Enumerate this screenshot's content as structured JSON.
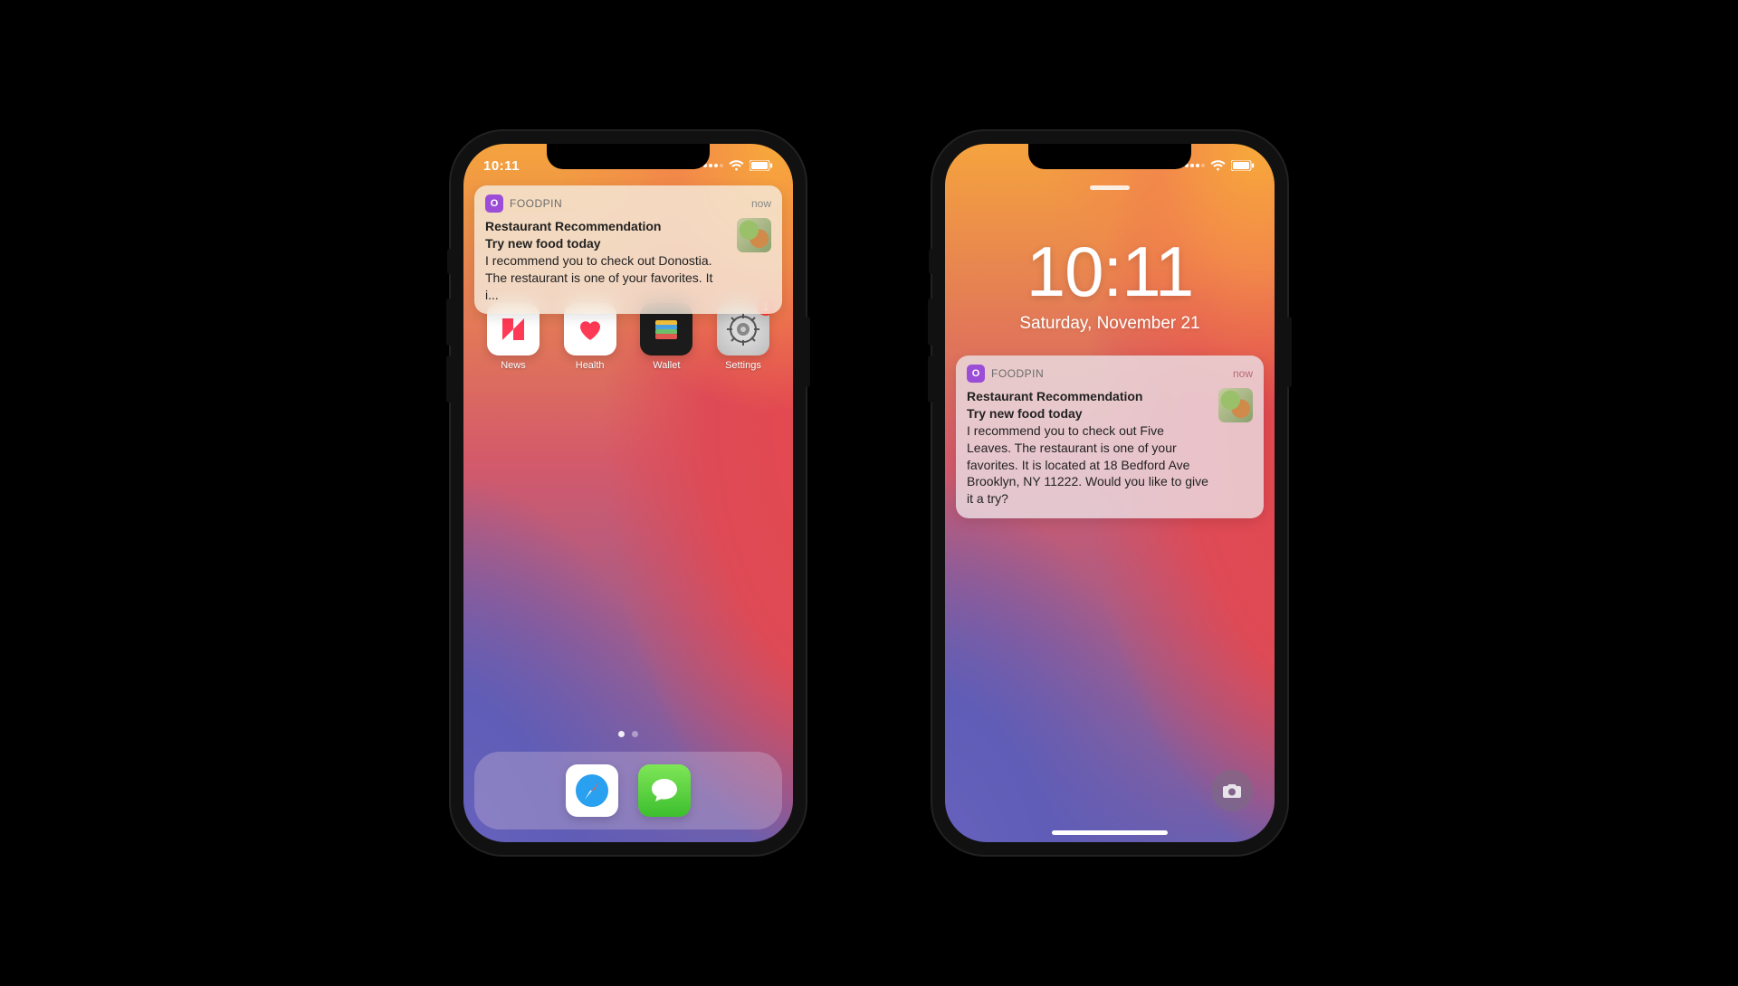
{
  "phone1": {
    "status_time": "10:11",
    "notif": {
      "app_icon_letter": "O",
      "app_name": "FOODPIN",
      "time": "now",
      "title": "Restaurant Recommendation",
      "subtitle": "Try new food today",
      "body": "I recommend you to check out Donostia. The restaurant is one of your favorites. It i..."
    },
    "apps": {
      "news": "News",
      "health": "Health",
      "wallet": "Wallet",
      "settings": "Settings",
      "settings_badge": "1"
    }
  },
  "phone2": {
    "lock_time": "10:11",
    "lock_date": "Saturday, November 21",
    "notif": {
      "app_icon_letter": "O",
      "app_name": "FOODPIN",
      "time": "now",
      "title": "Restaurant Recommendation",
      "subtitle": "Try new food today",
      "body": "I recommend you to check out Five Leaves. The restaurant is one of your favorites. It is located at 18 Bedford Ave Brooklyn, NY 11222. Would you like to give it a try?"
    }
  },
  "colors": {
    "badge_red": "#ff3b30",
    "app_purple": "#9b4dd8"
  }
}
